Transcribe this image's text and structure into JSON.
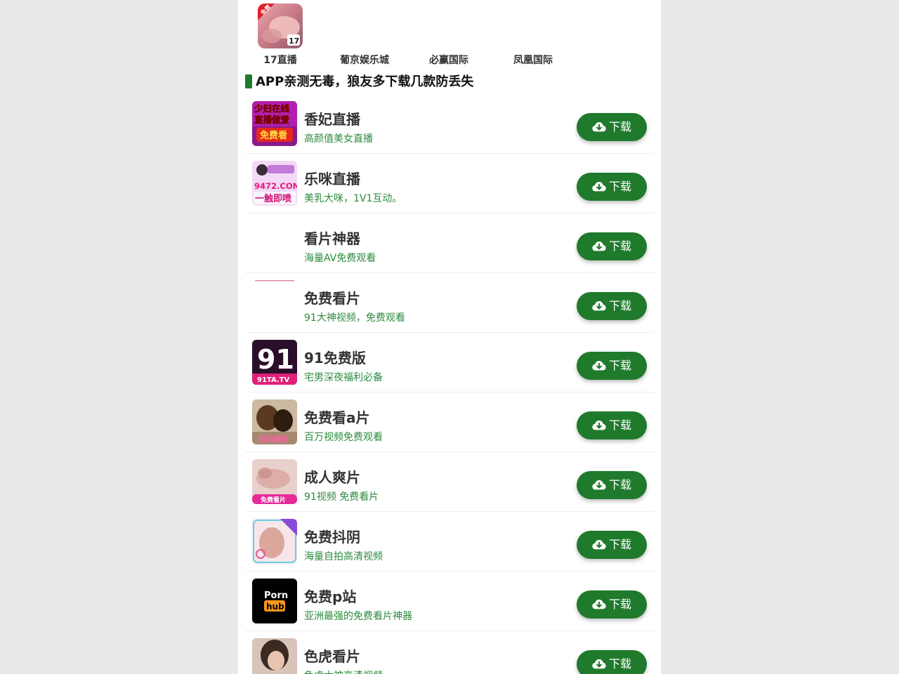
{
  "top_apps": [
    {
      "label": "17直播",
      "icon": "live-stream-icon",
      "badge": "免费",
      "mark": "17"
    },
    {
      "label": "葡京娱乐城",
      "icon": "casino-icon"
    },
    {
      "label": "必赢国际",
      "icon": "casino-icon"
    },
    {
      "label": "凤凰国际",
      "icon": "casino-icon"
    }
  ],
  "section": {
    "title": "APP亲测无毒，狼友多下载几款防丢失"
  },
  "apps": [
    {
      "name": "香妃直播",
      "desc": "高颜值美女直播",
      "download_label": "下载",
      "icon": "live-stream-icon",
      "icon_lines": [
        "少妇在线",
        "直播做爱",
        "免费看"
      ]
    },
    {
      "name": "乐咪直播",
      "desc": "美乳大咪，1V1互动。",
      "download_label": "下载",
      "icon": "live-stream-icon",
      "icon_lines": [
        "9472.COM",
        "一触即喷"
      ]
    },
    {
      "name": "看片神器",
      "desc": "海量AV免费观看",
      "download_label": "下载",
      "icon": "video-app-icon"
    },
    {
      "name": "免费看片",
      "desc": "91大神视频，免费观看",
      "download_label": "下载",
      "icon": "video-app-icon"
    },
    {
      "name": "91免费版",
      "desc": "宅男深夜福利必备",
      "download_label": "下载",
      "icon": "video-app-icon",
      "icon_lines": [
        "91",
        "91TA.TV"
      ]
    },
    {
      "name": "免费看a片",
      "desc": "百万视频免费观看",
      "download_label": "下载",
      "icon": "video-app-icon",
      "icon_lines": [
        "无码偷拍"
      ]
    },
    {
      "name": "成人爽片",
      "desc": "91视频 免费看片",
      "download_label": "下载",
      "icon": "video-app-icon",
      "icon_lines": [
        "免费看片"
      ]
    },
    {
      "name": "免费抖阴",
      "desc": "海量自拍高清视频",
      "download_label": "下载",
      "icon": "video-app-icon"
    },
    {
      "name": "免费p站",
      "desc": "亚洲最强的免费看片神器",
      "download_label": "下载",
      "icon": "video-app-icon",
      "icon_lines": [
        "Porn",
        "hub"
      ]
    },
    {
      "name": "色虎看片",
      "desc": "色虎大神高清视频",
      "download_label": "下载",
      "icon": "video-app-icon"
    }
  ],
  "colors": {
    "accent": "#1f7a2c",
    "desc_text": "#2b8a3e",
    "page_bg": "#e8e8e8"
  }
}
